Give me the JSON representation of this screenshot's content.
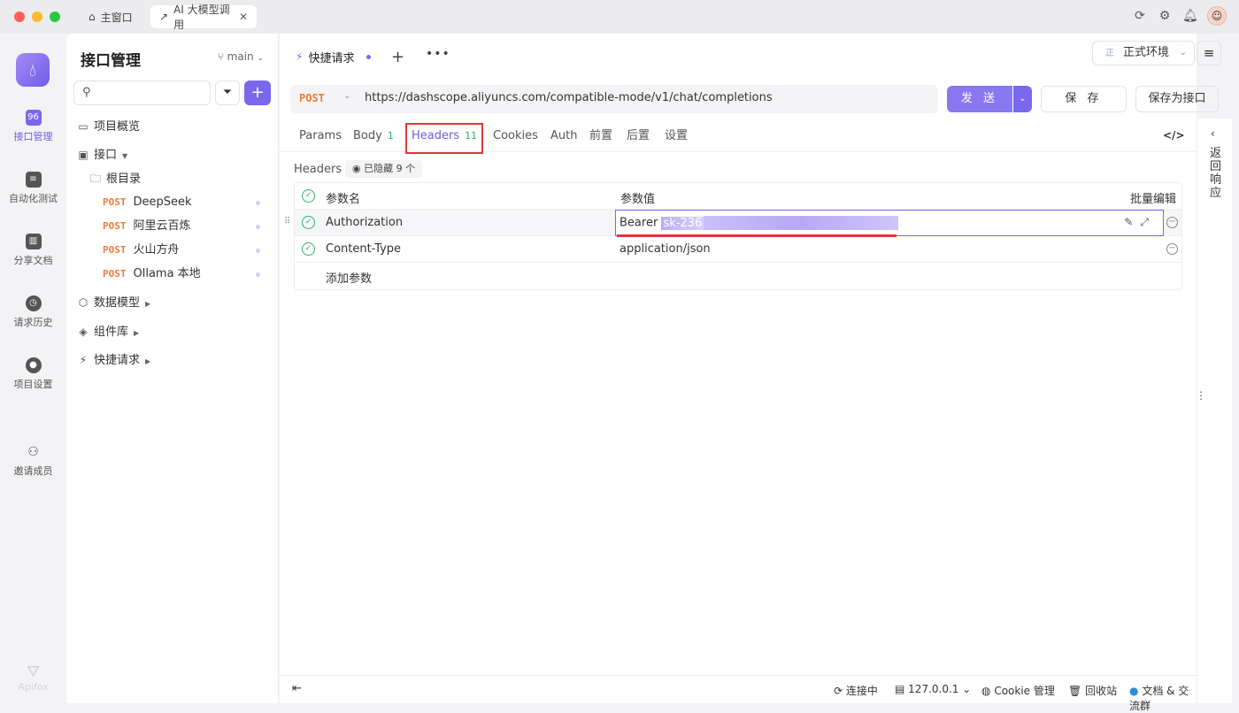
{
  "titlebar": {
    "tabs": [
      {
        "label": "主窗口",
        "icon": "home-icon"
      },
      {
        "label": "AI 大模型调用",
        "icon": "external-link-icon"
      }
    ],
    "colors": {
      "close": "#fe5f57",
      "min": "#febc2e",
      "max": "#28c840"
    }
  },
  "leftnav": {
    "items": [
      {
        "label": "接口管理",
        "icon": "api-icon",
        "active": true
      },
      {
        "label": "自动化测试",
        "icon": "automation-icon"
      },
      {
        "label": "分享文档",
        "icon": "book-icon"
      },
      {
        "label": "请求历史",
        "icon": "clock-icon"
      },
      {
        "label": "项目设置",
        "icon": "settings-icon"
      },
      {
        "label": "邀请成员",
        "icon": "invite-user-icon"
      }
    ],
    "brand": "Apifox"
  },
  "sidebar": {
    "title": "接口管理",
    "branch": "main",
    "tree": {
      "overview": "项目概览",
      "api": "接口",
      "root": "根目录",
      "endpoints": [
        {
          "method": "POST",
          "name": "DeepSeek"
        },
        {
          "method": "POST",
          "name": "阿里云百炼"
        },
        {
          "method": "POST",
          "name": "火山方舟"
        },
        {
          "method": "POST",
          "name": "Ollama 本地"
        }
      ],
      "data_model": "数据模型",
      "components": "组件库",
      "quick_request": "快捷请求"
    }
  },
  "main": {
    "request_tab": "快捷请求",
    "environment": {
      "prefix": "正",
      "label": "正式环境"
    },
    "method": "POST",
    "url": "https://dashscope.aliyuncs.com/compatible-mode/v1/chat/completions",
    "send": "发 送",
    "save": "保 存",
    "save_as_api": "保存为接口",
    "subtabs": {
      "params": "Params",
      "body": "Body",
      "body_count": "1",
      "headers": "Headers",
      "headers_count": "11",
      "cookies": "Cookies",
      "auth": "Auth",
      "pre": "前置",
      "post": "后置",
      "settings": "设置"
    },
    "headers_section": {
      "label": "Headers",
      "hidden": "已隐藏 9 个",
      "col_name": "参数名",
      "col_value": "参数值",
      "bulk_edit": "批量编辑",
      "rows": [
        {
          "key": "Authorization",
          "value_prefix": "Bearer ",
          "value_selected": "sk-236"
        },
        {
          "key": "Content-Type",
          "value": "application/json"
        }
      ],
      "add_placeholder": "添加参数"
    }
  },
  "right_panel": {
    "label": "返回响应"
  },
  "footer": {
    "connecting": "连接中",
    "host": "127.0.0.1",
    "cookie": "Cookie 管理",
    "trash": "回收站",
    "docs": "文档 & 交流群"
  }
}
